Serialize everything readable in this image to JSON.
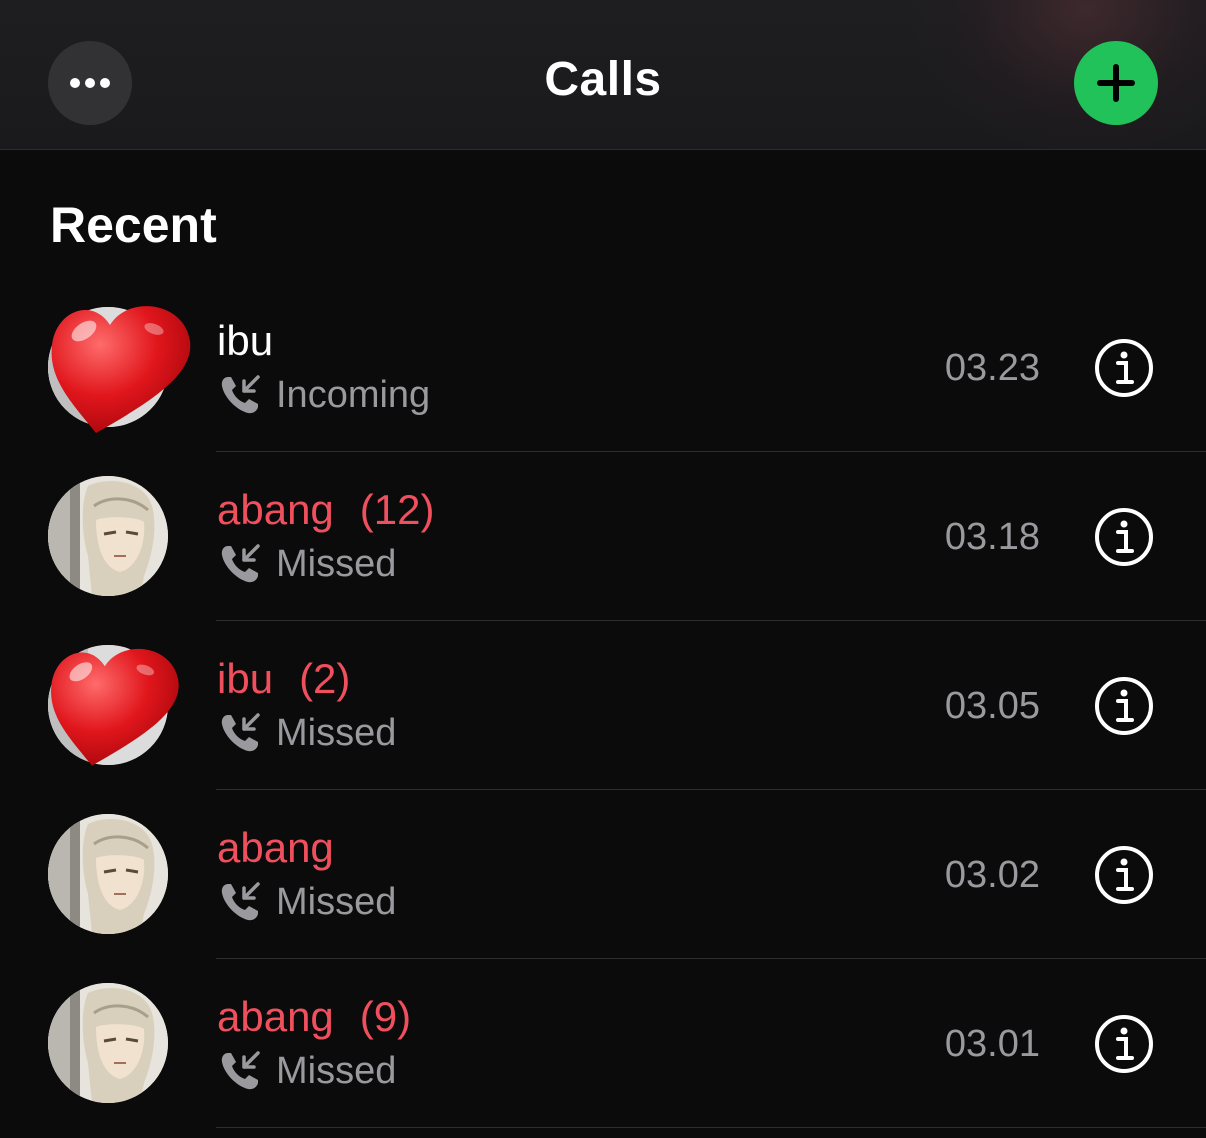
{
  "header": {
    "title": "Calls",
    "more_icon": "ellipsis-icon",
    "add_icon": "plus-icon",
    "add_color": "#21c25a"
  },
  "recent": {
    "heading": "Recent",
    "calls": [
      {
        "name": "ibu",
        "count": "",
        "status": "Incoming",
        "time": "03.23",
        "missed": false,
        "avatar": "heart-sticker-avatar"
      },
      {
        "name": "abang",
        "count": "(12)",
        "status": "Missed",
        "time": "03.18",
        "missed": true,
        "avatar": "anime-portrait-avatar"
      },
      {
        "name": "ibu",
        "count": "(2)",
        "status": "Missed",
        "time": "03.05",
        "missed": true,
        "avatar": "heart-sticker-avatar"
      },
      {
        "name": "abang",
        "count": "",
        "status": "Missed",
        "time": "03.02",
        "missed": true,
        "avatar": "anime-portrait-avatar"
      },
      {
        "name": "abang",
        "count": "(9)",
        "status": "Missed",
        "time": "03.01",
        "missed": true,
        "avatar": "anime-portrait-avatar"
      }
    ]
  },
  "colors": {
    "missed": "#f0505e",
    "secondary_text": "#9a9a9e"
  }
}
